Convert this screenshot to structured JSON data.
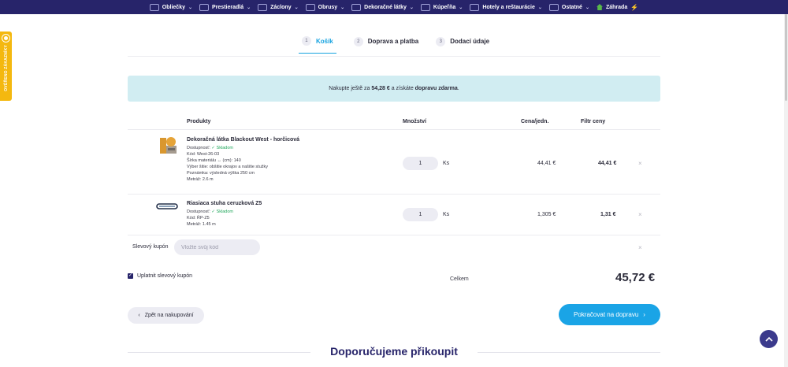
{
  "nav": {
    "items": [
      {
        "label": "Obliečky",
        "icon": "bedding-icon",
        "chevron": true
      },
      {
        "label": "Prestieradlá",
        "icon": "sheet-icon",
        "chevron": true
      },
      {
        "label": "Záclony",
        "icon": "curtain-icon",
        "chevron": true
      },
      {
        "label": "Obrusy",
        "icon": "tablecloth-icon",
        "chevron": true
      },
      {
        "label": "Dekoračné látky",
        "icon": "fabric-icon",
        "chevron": true
      },
      {
        "label": "Kúpeľňa",
        "icon": "bathroom-icon",
        "chevron": true
      },
      {
        "label": "Hotely a reštaurácie",
        "icon": "hotel-icon",
        "chevron": true
      },
      {
        "label": "Ostatné",
        "icon": "other-icon",
        "chevron": true
      },
      {
        "label": "Záhrada",
        "icon": "garden-icon",
        "chevron": false
      }
    ]
  },
  "verified_tab": {
    "label": "OVĚŘENO ZÁKAZNÍKY"
  },
  "steps": [
    {
      "num": "1",
      "label": "Košík",
      "active": true
    },
    {
      "num": "2",
      "label": "Doprava a platba",
      "active": false
    },
    {
      "num": "3",
      "label": "Dodací údaje",
      "active": false
    }
  ],
  "banner": {
    "prefix": "Nakupte ještě za ",
    "amount": "54,28 €",
    "middle": " a získáte ",
    "highlight": "dopravu zdarma",
    "suffix": "."
  },
  "table": {
    "headers": {
      "products": "Produkty",
      "quantity": "Množství",
      "unit_price": "Cena/jedn.",
      "total": "Filtr ceny"
    },
    "rows": [
      {
        "name": "Dekoračná látka Blackout West - horčicová",
        "availability_label": "Dostupnosť:",
        "availability_value": "✓ Skladom",
        "lines": [
          "Kód: West-26-03",
          "Šírka materiálu ↔ (cm): 140",
          "Výber šitie: obšitie okrajov a našitie stužky",
          "Poznámka: výsledná výška 250 cm",
          "Metráž: 2.6 m"
        ],
        "qty": "1",
        "unit": "Ks",
        "unit_price": "44,41 €",
        "total": "44,41 €"
      },
      {
        "name": "Riasiaca stuha ceruzková Z5",
        "availability_label": "Dostupnosť:",
        "availability_value": "✓ Skladom",
        "lines": [
          "Kód: ŘP-Z5",
          "Metráž: 1.45 m"
        ],
        "qty": "1",
        "unit": "Ks",
        "unit_price": "1,305 €",
        "total": "1,31 €"
      }
    ],
    "remove_glyph": "×"
  },
  "coupon": {
    "label": "Slevový kupón",
    "placeholder": "Vložte svůj kód",
    "apply_label": "Uplatnit slevový kupón",
    "checked": true
  },
  "summary": {
    "label": "Celkem",
    "value": "45,72 €"
  },
  "buttons": {
    "back": "Zpět na nakupování",
    "back_icon": "‹",
    "continue": "Pokračovat na dopravu",
    "continue_icon": "›"
  },
  "recommend_title": "Doporučujeme přikoupit",
  "colors": {
    "nav_bg": "#27246a",
    "accent": "#17a3e0",
    "banner_bg": "#d1edf2",
    "success": "#1fa65a",
    "verified": "#f4b80f"
  }
}
